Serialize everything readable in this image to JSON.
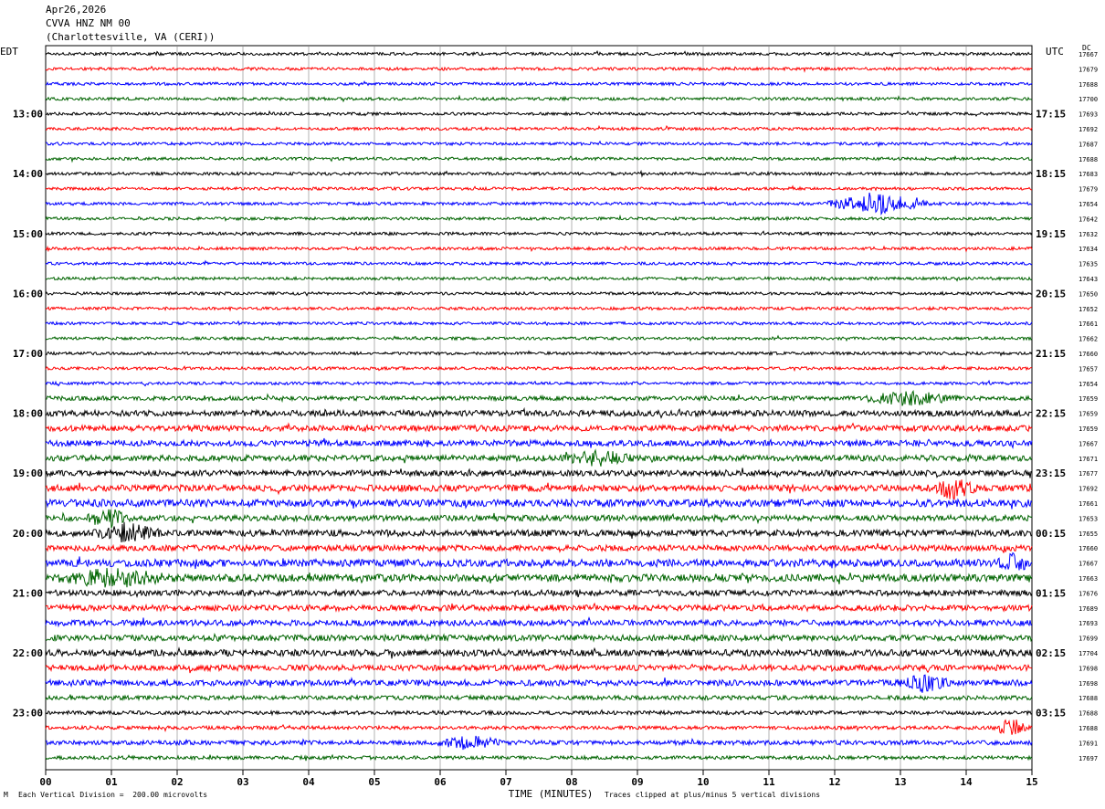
{
  "header": {
    "date": "Apr26,2026",
    "station": "CVVA HNZ NM 00",
    "location": "(Charlottesville, VA (CERI))"
  },
  "left_zone_label": "EDT",
  "right_zone_label": "UTC",
  "dc_label": "DC",
  "footer": {
    "scale_note": "Each Vertical Division =  200.00 microvolts",
    "clip_note": "Traces clipped at plus/minus 5 vertical divisions",
    "corner_mark": "M"
  },
  "colors": {
    "black": "#000000",
    "red": "#ff0000",
    "blue": "#0000ff",
    "green": "#006400",
    "grid": "#808080"
  },
  "chart_data": {
    "type": "line",
    "title": "CVVA HNZ NM 00",
    "xlabel": "TIME (MINUTES)",
    "ylabel": "",
    "x_ticks": [
      "00",
      "01",
      "02",
      "03",
      "04",
      "05",
      "06",
      "07",
      "08",
      "09",
      "10",
      "11",
      "12",
      "13",
      "14",
      "15"
    ],
    "xlim": [
      0,
      15
    ],
    "minutes_per_line": 15,
    "traces_per_hour": 4,
    "color_cycle": [
      "black",
      "red",
      "blue",
      "green"
    ],
    "left_hour_labels": [
      "13:00",
      "14:00",
      "15:00",
      "16:00",
      "17:00",
      "18:00",
      "19:00",
      "20:00",
      "21:00",
      "22:00",
      "23:00"
    ],
    "right_hour_labels": [
      "17:15",
      "18:15",
      "19:15",
      "20:15",
      "21:15",
      "22:15",
      "23:15",
      "00:15",
      "01:15",
      "02:15",
      "03:15"
    ],
    "trace_dc_offsets": [
      17667,
      17679,
      17688,
      17700,
      17693,
      17692,
      17687,
      17688,
      17683,
      17679,
      17654,
      17642,
      17632,
      17634,
      17635,
      17643,
      17650,
      17652,
      17661,
      17662,
      17660,
      17657,
      17654,
      17659,
      17659,
      17659,
      17667,
      17671,
      17677,
      17692,
      17661,
      17653,
      17655,
      17660,
      17667,
      17663,
      17676,
      17689,
      17693,
      17699,
      17704,
      17698,
      17698,
      17688,
      17688,
      17688,
      17691,
      17697
    ],
    "trace_noise_level": [
      1,
      1,
      1,
      1,
      1,
      1,
      1,
      1,
      1,
      1,
      1,
      1,
      1,
      1,
      1,
      1,
      1,
      1,
      1,
      1,
      1,
      1,
      1,
      1.5,
      2,
      2,
      2,
      2,
      2,
      2.2,
      2.5,
      2,
      2.2,
      2,
      2.5,
      2.5,
      2,
      2,
      2,
      2,
      2.2,
      2,
      2,
      1.5,
      1.3,
      1.2,
      1.5,
      1.2
    ],
    "events": [
      {
        "trace": 10,
        "start_min": 11.8,
        "end_min": 13.5,
        "amplitude": 8
      },
      {
        "trace": 23,
        "start_min": 12.3,
        "end_min": 14.0,
        "amplitude": 5
      },
      {
        "trace": 27,
        "start_min": 7.8,
        "end_min": 9.0,
        "amplitude": 5
      },
      {
        "trace": 29,
        "start_min": 13.4,
        "end_min": 14.2,
        "amplitude": 7
      },
      {
        "trace": 31,
        "start_min": 0.6,
        "end_min": 1.3,
        "amplitude": 7
      },
      {
        "trace": 32,
        "start_min": 0.7,
        "end_min": 1.8,
        "amplitude": 6
      },
      {
        "trace": 34,
        "start_min": 14.4,
        "end_min": 15.0,
        "amplitude": 6
      },
      {
        "trace": 35,
        "start_min": 0.0,
        "end_min": 2.0,
        "amplitude": 6
      },
      {
        "trace": 42,
        "start_min": 12.9,
        "end_min": 13.8,
        "amplitude": 6
      },
      {
        "trace": 45,
        "start_min": 14.4,
        "end_min": 15.0,
        "amplitude": 7
      },
      {
        "trace": 46,
        "start_min": 5.9,
        "end_min": 7.0,
        "amplitude": 5
      }
    ]
  }
}
